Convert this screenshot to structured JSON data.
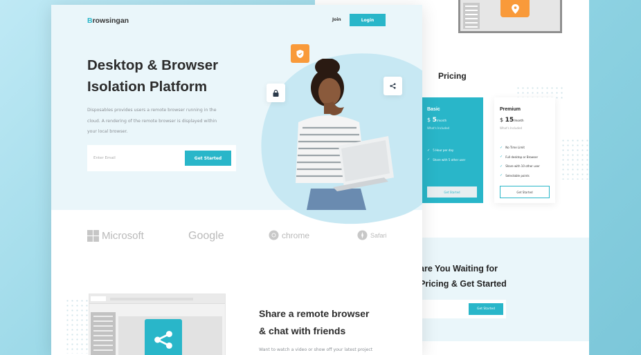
{
  "header": {
    "logo_initial": "B",
    "logo_rest": "rowsingan",
    "join_label": "Join",
    "login_label": "Login"
  },
  "hero": {
    "title_line1": "Desktop & Browser",
    "title_line2": "Isolation Platform",
    "description": "Disposables provides users a remote browser running in the cloud. A rendering of the remote browser is displayed within your local browser.",
    "email_placeholder": "Enter Email",
    "cta_label": "Get Started"
  },
  "brands": [
    "Microsoft",
    "Google",
    "chrome",
    "Safari"
  ],
  "feature": {
    "title_line1": "Share a remote browser",
    "title_line2": "& chat with friends",
    "description": "Want to watch a video or show off your latest project"
  },
  "pricing": {
    "title": "Pricing",
    "plans": [
      {
        "name": "Basic",
        "currency": "$",
        "price": "5",
        "period": "/month",
        "included_label": "What's Included",
        "features": [
          "5 Hour per day",
          "Share with 5 other user"
        ],
        "button": "Get Started"
      },
      {
        "name": "Premium",
        "currency": "$",
        "price": "15",
        "period": "/month",
        "included_label": "What's Included",
        "features": [
          "No Time Limit",
          "Full desktop or Browser",
          "Share with 10 other user",
          "Selectable points"
        ],
        "button": "Get Started"
      }
    ]
  },
  "cta_section": {
    "line1": "are You Waiting for",
    "line2": "Pricing & Get Started",
    "button": "Get Started"
  },
  "colors": {
    "accent": "#29b6c9",
    "orange": "#f99a3a",
    "hero_bg": "#eaf6fa",
    "heading": "#2b2b2b"
  },
  "icons": {
    "shield": "shield-icon",
    "lock": "lock-icon",
    "share": "share-icon",
    "check": "check-icon"
  }
}
